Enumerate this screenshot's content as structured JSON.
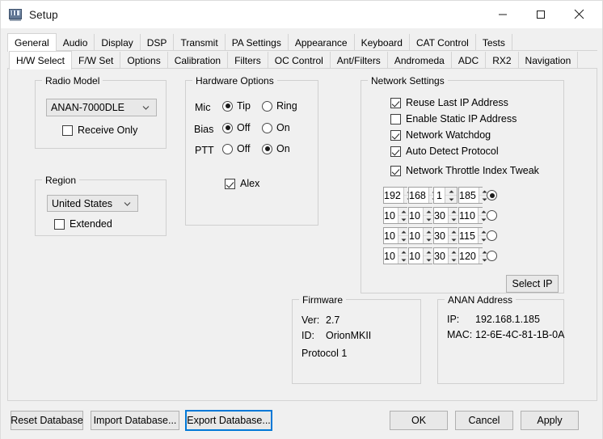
{
  "window": {
    "title": "Setup",
    "icon": "radio-icon",
    "controls": {
      "minimize": "minimize-icon",
      "maximize": "maximize-icon",
      "close": "close-icon"
    }
  },
  "tabs_primary": {
    "items": [
      {
        "label": "General",
        "active": true
      },
      {
        "label": "Audio",
        "active": false
      },
      {
        "label": "Display",
        "active": false
      },
      {
        "label": "DSP",
        "active": false
      },
      {
        "label": "Transmit",
        "active": false
      },
      {
        "label": "PA Settings",
        "active": false
      },
      {
        "label": "Appearance",
        "active": false
      },
      {
        "label": "Keyboard",
        "active": false
      },
      {
        "label": "CAT Control",
        "active": false
      },
      {
        "label": "Tests",
        "active": false
      }
    ]
  },
  "tabs_secondary": {
    "items": [
      {
        "label": "H/W Select",
        "active": true
      },
      {
        "label": "F/W Set",
        "active": false
      },
      {
        "label": "Options",
        "active": false
      },
      {
        "label": "Calibration",
        "active": false
      },
      {
        "label": "Filters",
        "active": false
      },
      {
        "label": "OC Control",
        "active": false
      },
      {
        "label": "Ant/Filters",
        "active": false
      },
      {
        "label": "Andromeda",
        "active": false
      },
      {
        "label": "ADC",
        "active": false
      },
      {
        "label": "RX2",
        "active": false
      },
      {
        "label": "Navigation",
        "active": false
      }
    ]
  },
  "radio_model": {
    "title": "Radio Model",
    "combo_value": "ANAN-7000DLE",
    "receive_only": {
      "label": "Receive Only",
      "checked": false
    }
  },
  "region": {
    "title": "Region",
    "combo_value": "United States",
    "extended": {
      "label": "Extended",
      "checked": false
    }
  },
  "hardware_options": {
    "title": "Hardware Options",
    "rows": [
      {
        "name": "Mic",
        "options": [
          {
            "label": "Tip",
            "selected": true
          },
          {
            "label": "Ring",
            "selected": false
          }
        ]
      },
      {
        "name": "Bias",
        "options": [
          {
            "label": "Off",
            "selected": true
          },
          {
            "label": "On",
            "selected": false
          }
        ]
      },
      {
        "name": "PTT",
        "options": [
          {
            "label": "Off",
            "selected": false
          },
          {
            "label": "On",
            "selected": true
          }
        ]
      }
    ],
    "alex": {
      "label": "Alex",
      "checked": true
    }
  },
  "network_settings": {
    "title": "Network Settings",
    "checkboxes": [
      {
        "label": "Reuse Last IP Address",
        "checked": true
      },
      {
        "label": "Enable Static IP Address",
        "checked": false
      },
      {
        "label": "Network Watchdog",
        "checked": true
      },
      {
        "label": "Auto Detect Protocol",
        "checked": true
      },
      {
        "label": "Network Throttle Index Tweak",
        "checked": true
      }
    ],
    "ip_rows": [
      {
        "octets": [
          "192",
          "168",
          "1",
          "185"
        ],
        "selected": true
      },
      {
        "octets": [
          "10",
          "10",
          "30",
          "110"
        ],
        "selected": false
      },
      {
        "octets": [
          "10",
          "10",
          "30",
          "115"
        ],
        "selected": false
      },
      {
        "octets": [
          "10",
          "10",
          "30",
          "120"
        ],
        "selected": false
      }
    ],
    "select_ip_label": "Select IP"
  },
  "firmware": {
    "title": "Firmware",
    "ver_label": "Ver:",
    "ver_value": "2.7",
    "id_label": "ID:",
    "id_value": "OrionMKII",
    "protocol": "Protocol 1"
  },
  "anan_address": {
    "title": "ANAN Address",
    "ip_label": "IP:",
    "ip_value": "192.168.1.185",
    "mac_label": "MAC:",
    "mac_value": "12-6E-4C-81-1B-0A"
  },
  "footer": {
    "reset_database": "Reset Database",
    "import_database": "Import Database...",
    "export_database": "Export Database...",
    "ok": "OK",
    "cancel": "Cancel",
    "apply": "Apply"
  },
  "colors": {
    "focus_accent": "#0078d7",
    "panel_bg": "#f0f0f0",
    "group_border": "#d0d0d0"
  }
}
